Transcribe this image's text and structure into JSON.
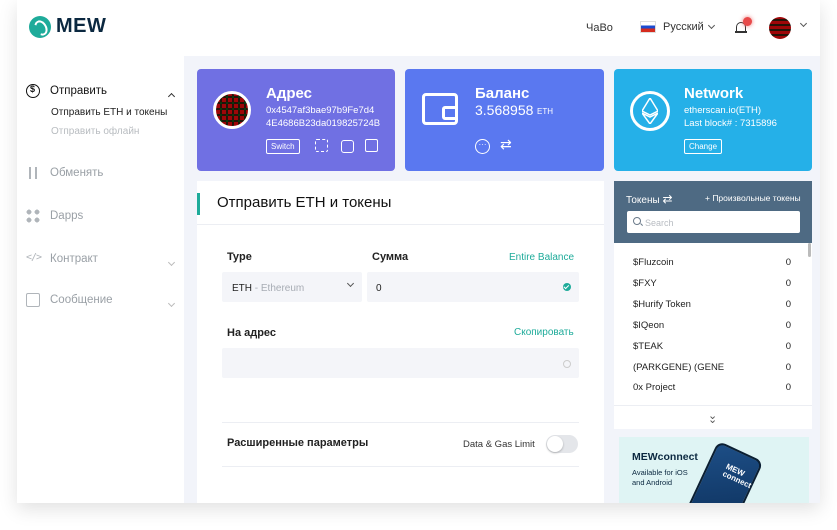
{
  "header": {
    "brand": "MEW",
    "faq": "ЧаВо",
    "language": "Русский"
  },
  "sidebar": {
    "items": [
      {
        "label": "Отправить",
        "active": true,
        "icon": "send-icon"
      },
      {
        "label": "Обменять",
        "icon": "swap-icon"
      },
      {
        "label": "Dapps",
        "icon": "dapps-icon"
      },
      {
        "label": "Контракт",
        "icon": "code-icon"
      },
      {
        "label": "Сообщение",
        "icon": "message-icon"
      }
    ],
    "sub_items": [
      "Отправить ETH и токены",
      "Отправить офлайн"
    ]
  },
  "cards": {
    "address": {
      "title": "Адрес",
      "line1": "0x4547af3bae97b9Fe7d4",
      "line2": "4E4686B23da019825724B",
      "switch": "Switch"
    },
    "balance": {
      "title": "Баланс",
      "value": "3.568958",
      "unit": "ETH"
    },
    "network": {
      "title": "Network",
      "line1": "etherscan.io(ETH)",
      "line2": "Last block# : 7315896",
      "change": "Change"
    }
  },
  "send": {
    "title": "Отправить ETH и токены",
    "type_label": "Type",
    "type_value": "ETH",
    "type_sub": " - Ethereum",
    "amount_label": "Сумма",
    "entire_balance": "Entire Balance",
    "amount_value": "0",
    "to_label": "На адрес",
    "copy": "Скопировать",
    "advanced": "Расширенные параметры",
    "data_gas": "Data & Gas Limit"
  },
  "tokens": {
    "title": "Токены",
    "custom": "+ Произвольные токены",
    "search_placeholder": "Search",
    "rows": [
      {
        "name": "$Fluzcoin",
        "value": "0"
      },
      {
        "name": "$FXY",
        "value": "0"
      },
      {
        "name": "$Hurify Token",
        "value": "0"
      },
      {
        "name": "$IQeon",
        "value": "0"
      },
      {
        "name": "$TEAK",
        "value": "0"
      },
      {
        "name": "(PARKGENE) (GENE",
        "value": "0"
      },
      {
        "name": "0x Project",
        "value": "0"
      }
    ]
  },
  "promo": {
    "title": "MEWconnect",
    "sub": "Available for iOS and Android",
    "phone_text1": "MEW",
    "phone_text2": "connect"
  }
}
